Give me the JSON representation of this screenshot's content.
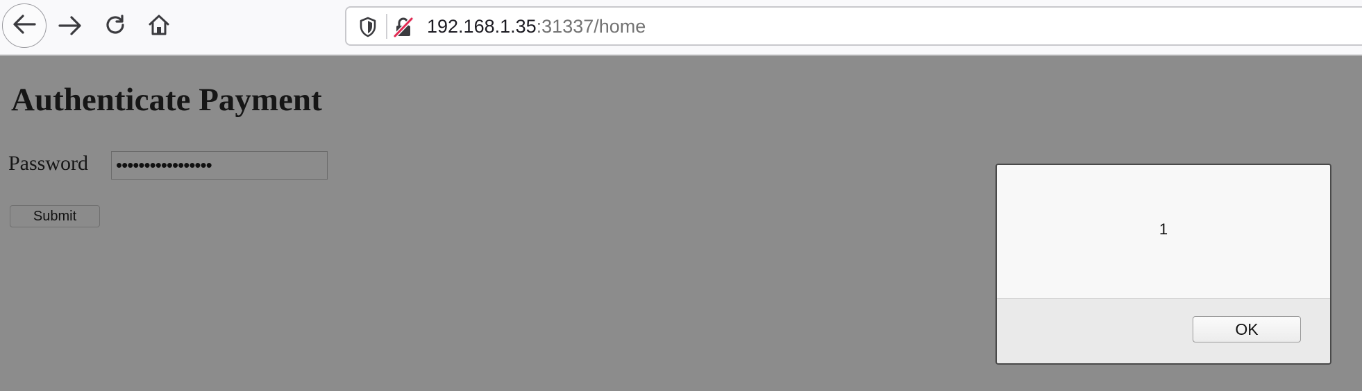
{
  "browser": {
    "url_host": "192.168.1.35",
    "url_rest": ":31337/home",
    "icons": {
      "back": "back-arrow-icon",
      "forward": "forward-arrow-icon",
      "reload": "reload-icon",
      "home": "home-icon",
      "tracking": "shield-icon",
      "security": "insecure-lock-icon"
    },
    "colors": {
      "insecure_slash": "#e22850"
    }
  },
  "page": {
    "title": "Authenticate Payment",
    "password_label": "Password",
    "password_value": "•••••••••••••••••",
    "submit_label": "Submit"
  },
  "alert": {
    "message": "1",
    "ok_label": "OK"
  }
}
